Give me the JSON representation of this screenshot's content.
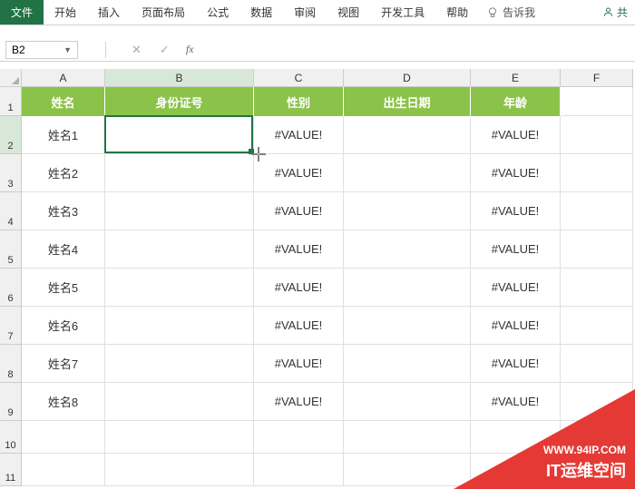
{
  "ribbon": {
    "tabs": [
      "文件",
      "开始",
      "插入",
      "页面布局",
      "公式",
      "数据",
      "审阅",
      "视图",
      "开发工具",
      "帮助"
    ],
    "tell_me": "告诉我",
    "share": "共"
  },
  "formula_bar": {
    "cell_ref": "B2",
    "fx": "fx"
  },
  "columns": [
    "A",
    "B",
    "C",
    "D",
    "E",
    "F"
  ],
  "row_nums": [
    "1",
    "2",
    "3",
    "4",
    "5",
    "6",
    "7",
    "8",
    "9",
    "10",
    "11"
  ],
  "headers": {
    "A": "姓名",
    "B": "身份证号",
    "C": "性别",
    "D": "出生日期",
    "E": "年龄"
  },
  "rows": [
    {
      "A": "姓名1",
      "B": "",
      "C": "#VALUE!",
      "D": "",
      "E": "#VALUE!"
    },
    {
      "A": "姓名2",
      "B": "",
      "C": "#VALUE!",
      "D": "",
      "E": "#VALUE!"
    },
    {
      "A": "姓名3",
      "B": "",
      "C": "#VALUE!",
      "D": "",
      "E": "#VALUE!"
    },
    {
      "A": "姓名4",
      "B": "",
      "C": "#VALUE!",
      "D": "",
      "E": "#VALUE!"
    },
    {
      "A": "姓名5",
      "B": "",
      "C": "#VALUE!",
      "D": "",
      "E": "#VALUE!"
    },
    {
      "A": "姓名6",
      "B": "",
      "C": "#VALUE!",
      "D": "",
      "E": "#VALUE!"
    },
    {
      "A": "姓名7",
      "B": "",
      "C": "#VALUE!",
      "D": "",
      "E": "#VALUE!"
    },
    {
      "A": "姓名8",
      "B": "",
      "C": "#VALUE!",
      "D": "",
      "E": "#VALUE!"
    }
  ],
  "watermark": {
    "line1": "WWW.94IP.COM",
    "line2": "IT运维空间"
  }
}
